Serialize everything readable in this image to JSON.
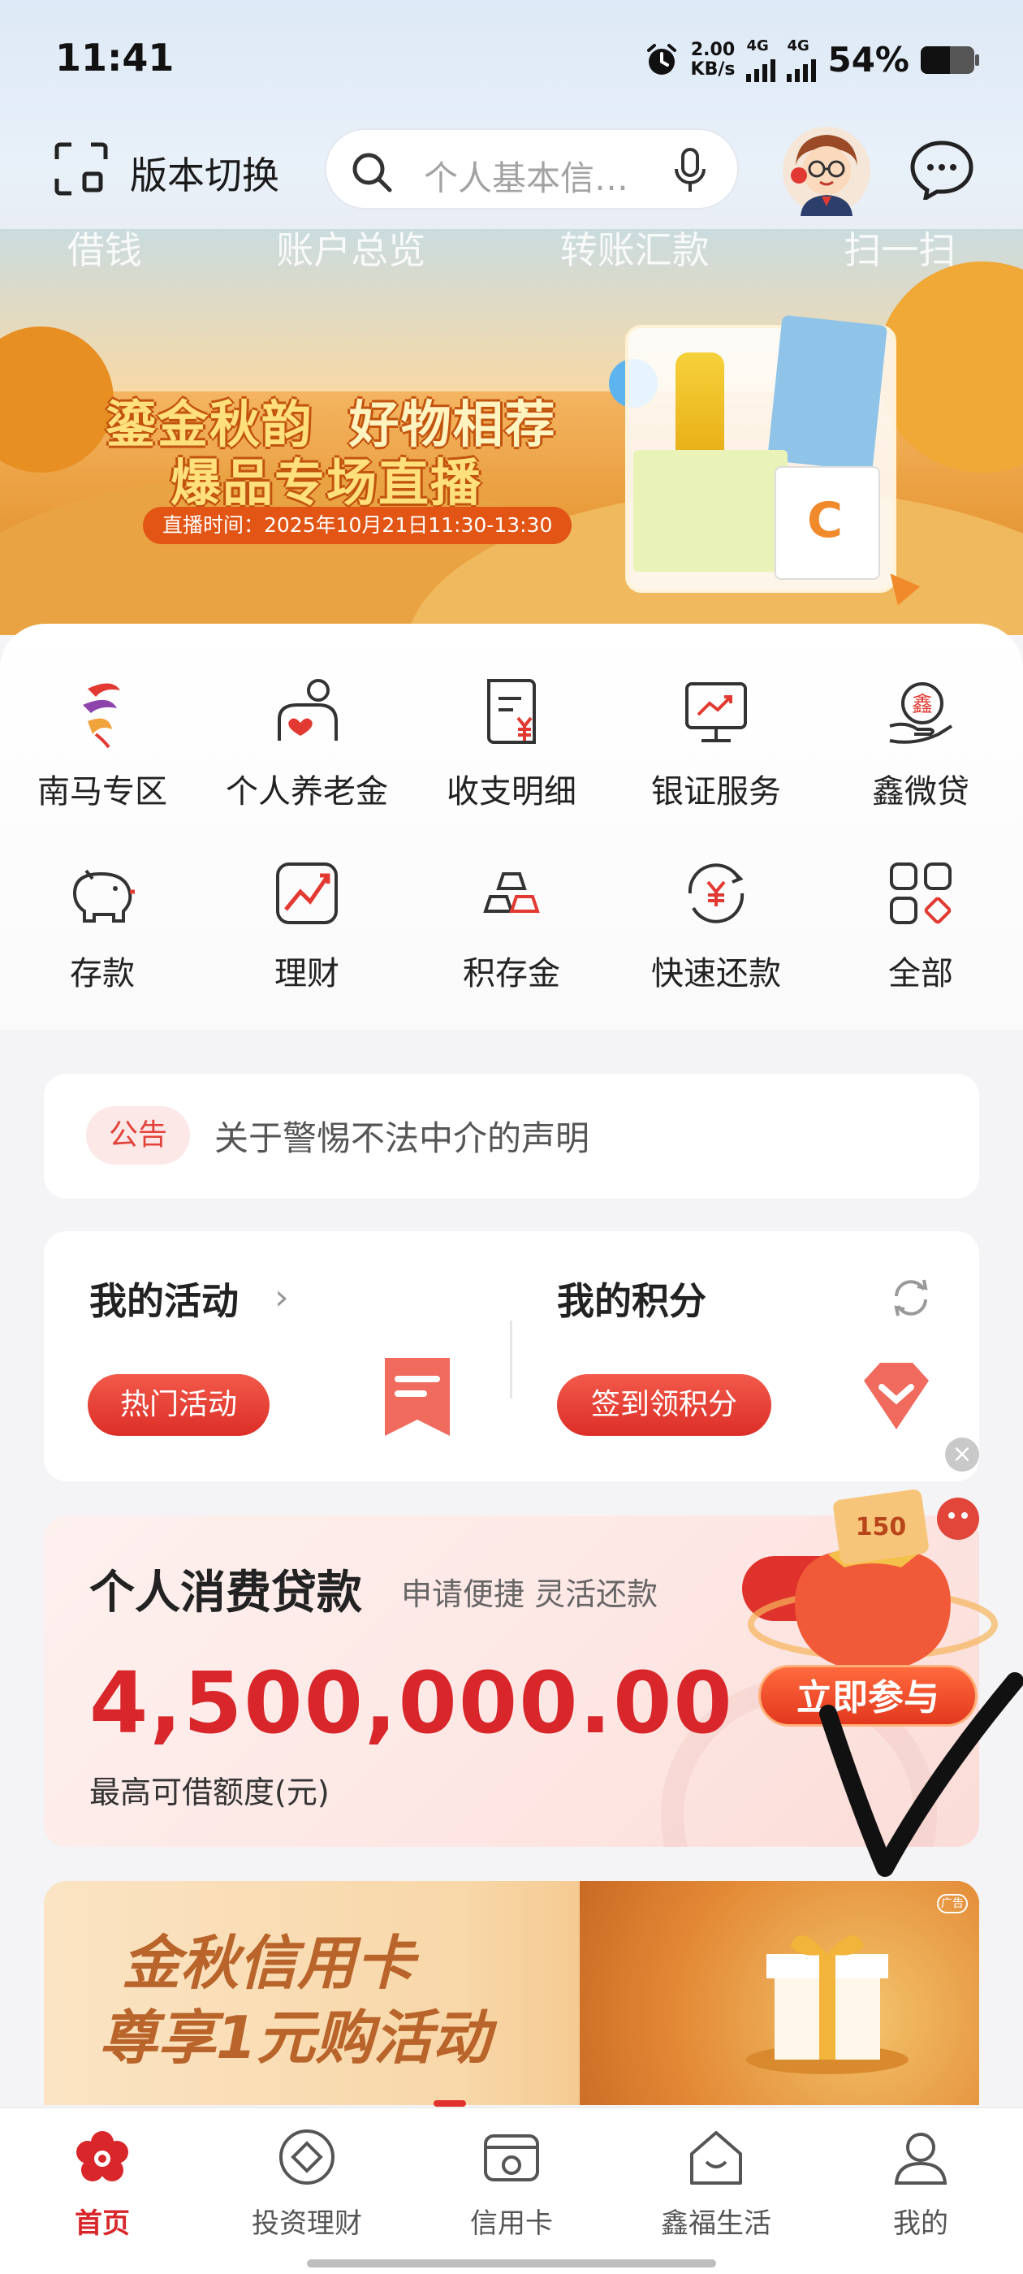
{
  "status_bar": {
    "time": "11:41",
    "net_speed_value": "2.00",
    "net_speed_unit": "KB/s",
    "sim1_label": "4G",
    "sim2_label": "4G",
    "battery_percent_text": "54%",
    "battery_level": 0.54
  },
  "header": {
    "version_switch_label": "版本切换",
    "search_placeholder": "个人基本信…",
    "icons": [
      "scan-switch-icon",
      "search-icon",
      "microphone-icon",
      "avatar",
      "chat-icon"
    ]
  },
  "banner": {
    "ghost_tabs": [
      "借钱",
      "账户总览",
      "转账汇款",
      "扫一扫"
    ],
    "title_line1_a": "鎏金秋韵",
    "title_line1_b": "好物相荐",
    "title_line2": "爆品专场直播",
    "live_time": "直播时间：2025年10月21日11:30-13:30",
    "product_logo_letter": "C"
  },
  "quick_menu": [
    {
      "label": "南马专区",
      "icon": "nanma-logo-icon"
    },
    {
      "label": "个人养老金",
      "icon": "pension-heart-icon"
    },
    {
      "label": "收支明细",
      "icon": "bill-detail-icon"
    },
    {
      "label": "银证服务",
      "icon": "stock-monitor-icon"
    },
    {
      "label": "鑫微贷",
      "icon": "micro-loan-icon"
    },
    {
      "label": "存款",
      "icon": "piggy-bank-icon"
    },
    {
      "label": "理财",
      "icon": "wealth-chart-icon"
    },
    {
      "label": "积存金",
      "icon": "gold-bars-icon"
    },
    {
      "label": "快速还款",
      "icon": "quick-repay-icon"
    },
    {
      "label": "全部",
      "icon": "all-grid-icon"
    }
  ],
  "notice": {
    "tag": "公告",
    "text": "关于警惕不法中介的声明"
  },
  "activity": {
    "title": "我的活动",
    "chevron": "›",
    "hot_button": "热门活动",
    "points_title": "我的积分",
    "checkin_button": "签到领积分"
  },
  "loan": {
    "title": "个人消费贷款",
    "subtitle": "申请便捷 灵活还款",
    "amount": "4,500,000.00",
    "caption": "最高可借额度(元)"
  },
  "promo_float": {
    "join_button": "立即参与",
    "badge_amount": "150"
  },
  "cc_banner": {
    "line1": "金秋信用卡",
    "line2": "尊享1元购活动",
    "ad_label": "广告"
  },
  "colors": {
    "brand_red": "#d8262a",
    "accent_red": "#e0322c",
    "notice_tag_bg": "#fde8e8"
  },
  "bottom_nav": [
    {
      "label": "首页",
      "icon": "home-flower-icon",
      "active": true
    },
    {
      "label": "投资理财",
      "icon": "invest-icon",
      "active": false
    },
    {
      "label": "信用卡",
      "icon": "credit-card-icon",
      "active": false
    },
    {
      "label": "鑫福生活",
      "icon": "life-house-icon",
      "active": false
    },
    {
      "label": "我的",
      "icon": "profile-icon",
      "active": false
    }
  ]
}
